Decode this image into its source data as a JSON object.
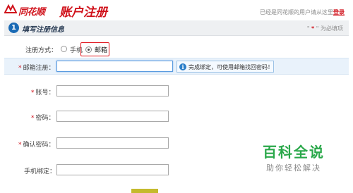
{
  "header": {
    "brand": "同花顺",
    "title": "账户注册",
    "login_hint_prefix": "已经是同花顺的用户请从这里",
    "login_link": "登录"
  },
  "section": {
    "step": "1",
    "title": "填写注册信息",
    "required_note_prefix": "\" ",
    "required_star": "*",
    "required_note_suffix": " \" 为必填项"
  },
  "reg_method": {
    "label": "注册方式：",
    "options": [
      "手机",
      "邮箱"
    ],
    "selected": "邮箱"
  },
  "fields": {
    "email": {
      "label": "邮箱注册：",
      "required": true,
      "value": ""
    },
    "account": {
      "label": "账号：",
      "required": true,
      "value": ""
    },
    "password": {
      "label": "密码：",
      "required": true,
      "value": ""
    },
    "confirm_password": {
      "label": "确认密码：",
      "required": true,
      "value": ""
    },
    "phone_bind": {
      "label": "手机绑定：",
      "required": false,
      "value": ""
    }
  },
  "hint": {
    "icon": "i",
    "text": "完成绑定，可使用邮箱找回密码！"
  },
  "star": "*",
  "watermark": {
    "title": "百科全说",
    "subtitle": "助你轻松解决"
  },
  "colors": {
    "brand_red": "#d0121b",
    "accent_blue": "#1a6ab5",
    "highlight_row": "#e9f2fb",
    "watermark_green": "#2aa84a"
  }
}
